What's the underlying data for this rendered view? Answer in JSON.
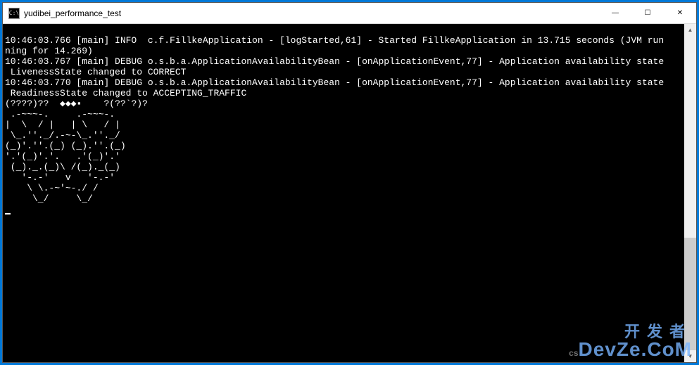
{
  "window": {
    "title": "yudibei_performance_test",
    "icon_label": "C:\\"
  },
  "controls": {
    "minimize": "—",
    "maximize": "☐",
    "close": "✕"
  },
  "scrollbar": {
    "up": "▲",
    "down": "▼"
  },
  "terminal": {
    "blank": "",
    "line1": "10:46:03.766 [main] INFO  c.f.FillkeApplication - [logStarted,61] - Started FillkeApplication in 13.715 seconds (JVM run",
    "line2": "ning for 14.269)",
    "line3": "10:46:03.767 [main] DEBUG o.s.b.a.ApplicationAvailabilityBean - [onApplicationEvent,77] - Application availability state",
    "line4": " LivenessState changed to CORRECT",
    "line5": "10:46:03.770 [main] DEBUG o.s.b.a.ApplicationAvailabilityBean - [onApplicationEvent,77] - Application availability state",
    "line6": " ReadinessState changed to ACCEPTING_TRAFFIC",
    "line7": "(????)??  ◆◆◆▪    ?(??`?)?",
    "art1": " .-~~~-.     .-~~~-.  ",
    "art2": "|  \\  / |   | \\   / | ",
    "art3": " \\_.''._/.-~-\\_.''._/ ",
    "art4": "(_)'.''.(_) (_).''.(_)",
    "art5": "'.'(_)'.'.   .'(_)'.' ",
    "art6": " (_)._.(_)\\ /(_)._(_) ",
    "art7": "   '-.-'   v   '-.-'  ",
    "art8": "    \\ \\.-~'~-./ /     ",
    "art9": "     \\_/     \\_/      "
  },
  "watermark": {
    "cn": "开发者",
    "en": "DevZe.CoM",
    "sub": "cs"
  }
}
